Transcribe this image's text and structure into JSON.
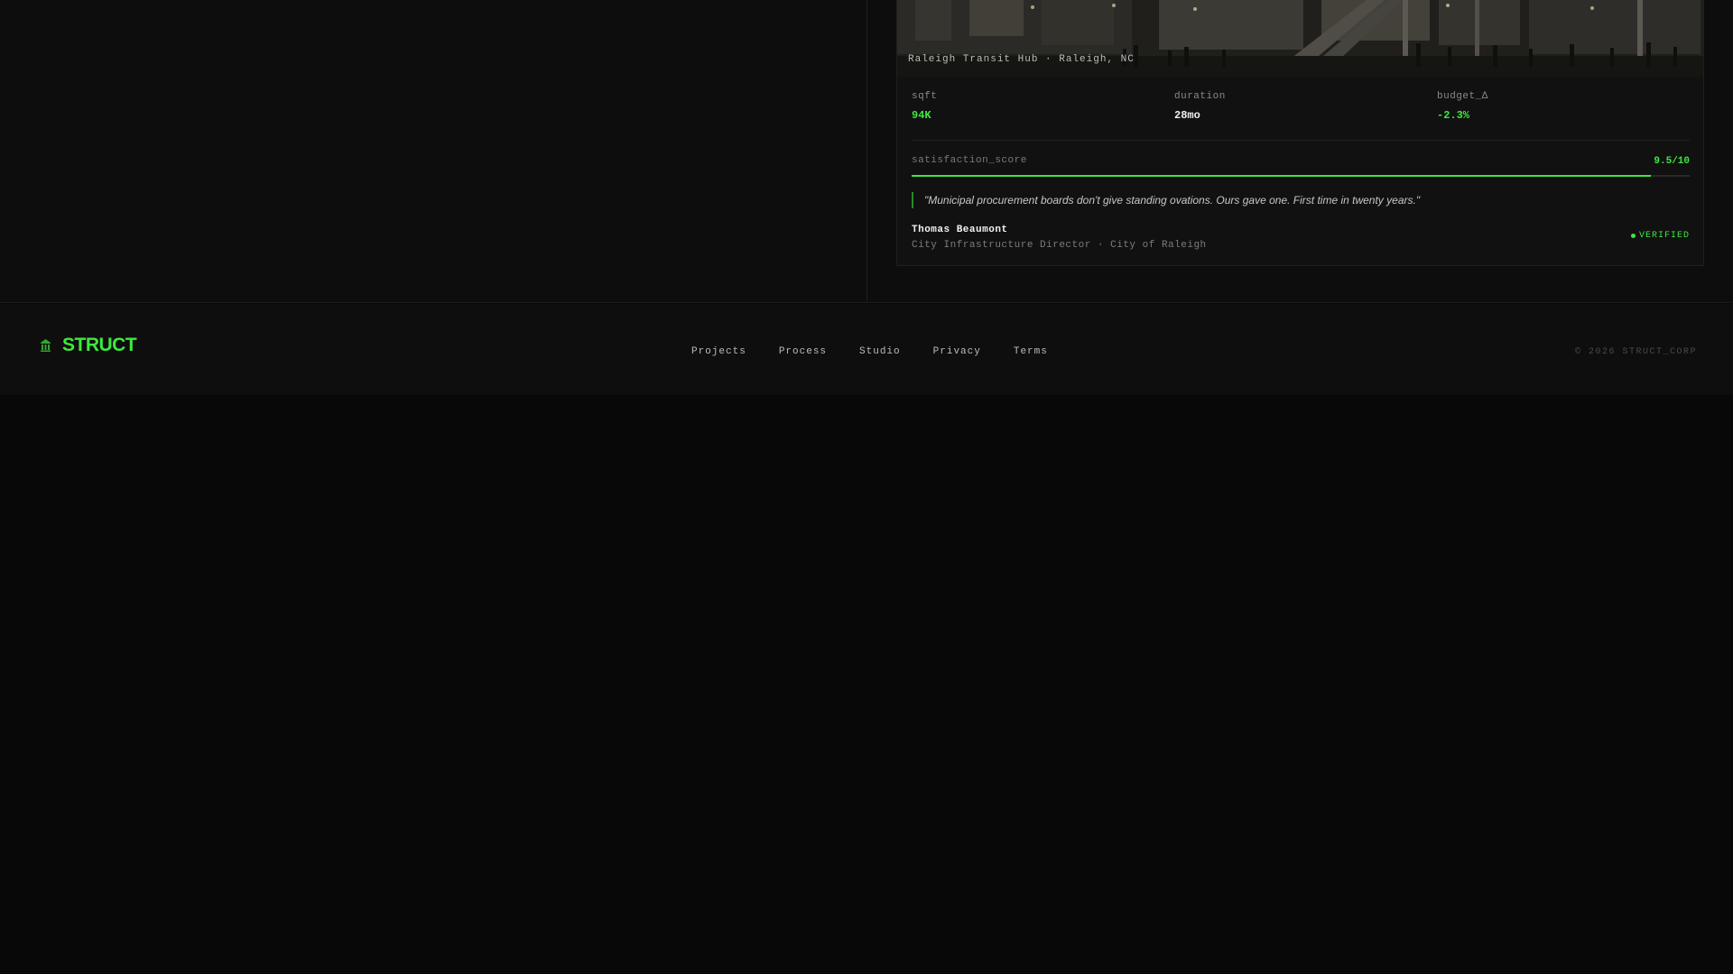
{
  "project": {
    "image_caption": "Raleigh Transit Hub · Raleigh, NC",
    "stats": [
      {
        "label": "sqft",
        "value": "94K",
        "accent": "#3ee83e"
      },
      {
        "label": "duration",
        "value": "28mo",
        "accent": "#f0f0f0"
      },
      {
        "label": "budget_Δ",
        "value": "-2.3%",
        "accent": "#3ee83e"
      }
    ],
    "satisfaction": {
      "label": "satisfaction_score",
      "value_text": "9.5/10",
      "value": 9.5,
      "max": 10
    },
    "quote": "\"Municipal procurement boards don't give standing ovations. Ours gave one. First time in twenty years.\"",
    "author": {
      "name": "Thomas Beaumont",
      "role": "City Infrastructure Director · City of Raleigh"
    },
    "badge": "VERIFIED"
  },
  "footer": {
    "brand": "STRUCT",
    "nav": [
      "Projects",
      "Process",
      "Studio",
      "Privacy",
      "Terms"
    ],
    "copyright": "© 2026 STRUCT_CORP"
  },
  "colors": {
    "accent": "#3ee83e",
    "background": "#080808",
    "surface": "#111111"
  },
  "icons": {
    "brand": "building-icon",
    "badge": "status-dot-icon"
  }
}
